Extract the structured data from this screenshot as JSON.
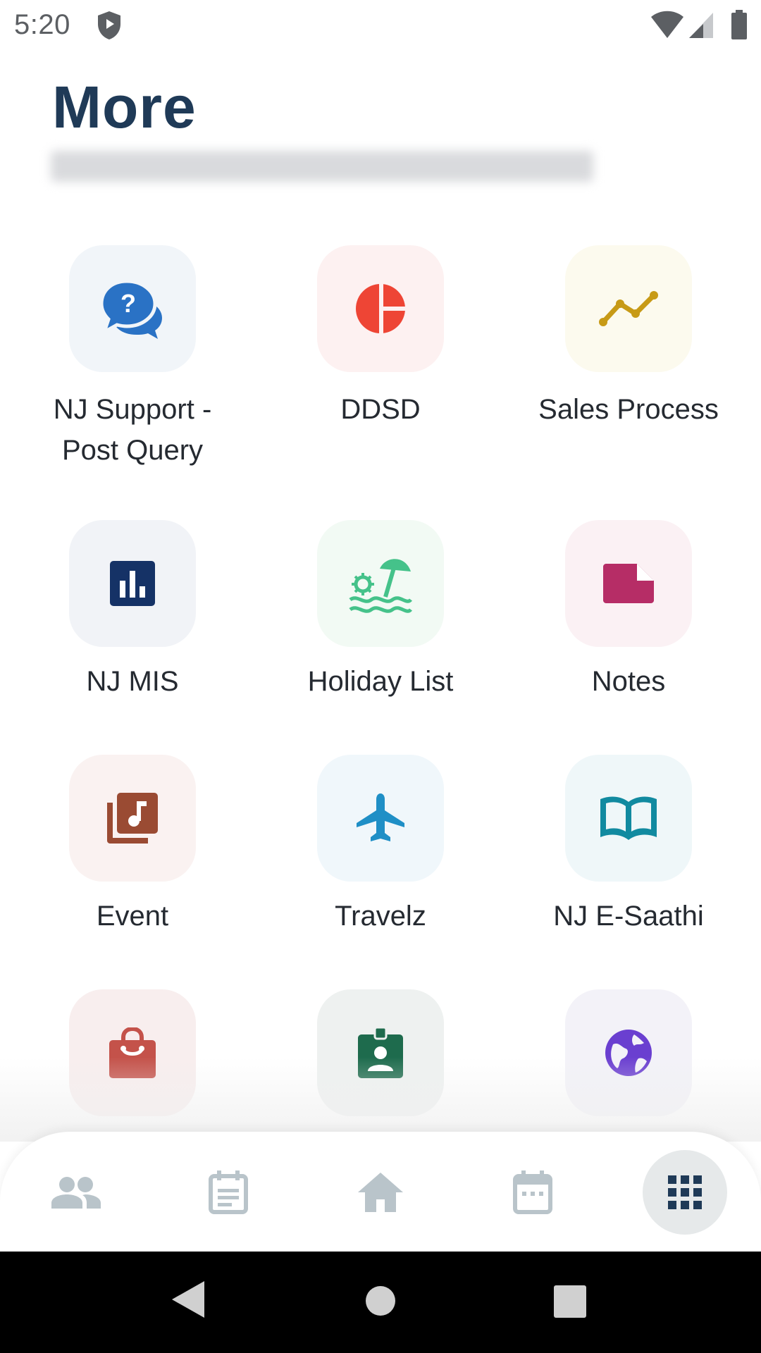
{
  "status_bar": {
    "time": "5:20"
  },
  "header": {
    "title": "More"
  },
  "grid": [
    {
      "label": "NJ Support -\nPost Query",
      "icon": "help-chat-icon",
      "bg": "#f1f5f9",
      "color": "#2a72c5"
    },
    {
      "label": "DDSD",
      "icon": "pie-chart-icon",
      "bg": "#fdf1f1",
      "color": "#ee4535"
    },
    {
      "label": "Sales Process",
      "icon": "trend-line-icon",
      "bg": "#fcfaee",
      "color": "#c79a16"
    },
    {
      "label": "NJ MIS",
      "icon": "bar-chart-icon",
      "bg": "#f1f3f7",
      "color": "#153266"
    },
    {
      "label": "Holiday List",
      "icon": "beach-umbrella-icon",
      "bg": "#f2faf4",
      "color": "#45c28a"
    },
    {
      "label": "Notes",
      "icon": "note-icon",
      "bg": "#fbf1f4",
      "color": "#b62d66"
    },
    {
      "label": "Event",
      "icon": "music-library-icon",
      "bg": "#faf2f1",
      "color": "#9a4b33"
    },
    {
      "label": "Travelz",
      "icon": "airplane-icon",
      "bg": "#f0f7fb",
      "color": "#1f8fc6"
    },
    {
      "label": "NJ E-Saathi",
      "icon": "book-icon",
      "bg": "#eff7f9",
      "color": "#118aa0"
    },
    {
      "label": "",
      "icon": "shopping-bag-icon",
      "bg": "#f8eeee",
      "color": "#c4524a"
    },
    {
      "label": "",
      "icon": "id-badge-icon",
      "bg": "#eef1f0",
      "color": "#1e6b4d"
    },
    {
      "label": "",
      "icon": "globe-icon",
      "bg": "#f3f2f8",
      "color": "#6a3fd0"
    }
  ],
  "bottom_nav": [
    {
      "icon": "people-icon",
      "active": false
    },
    {
      "icon": "article-icon",
      "active": false
    },
    {
      "icon": "home-icon",
      "active": false
    },
    {
      "icon": "calendar-icon",
      "active": false
    },
    {
      "icon": "apps-grid-icon",
      "active": true
    }
  ]
}
